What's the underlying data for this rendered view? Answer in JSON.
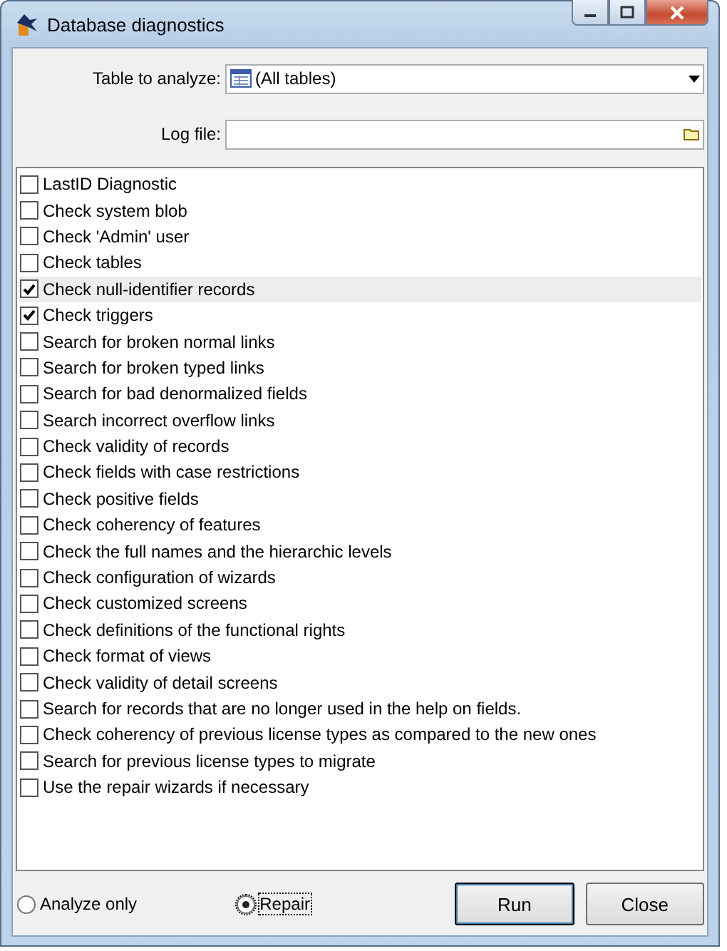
{
  "window": {
    "title": "Database diagnostics"
  },
  "table_field": {
    "label": "Table to analyze:",
    "value": "(All tables)"
  },
  "log_field": {
    "label": "Log file:"
  },
  "checks": [
    {
      "label": "LastID Diagnostic",
      "checked": false,
      "selected": false
    },
    {
      "label": "Check system blob",
      "checked": false,
      "selected": false
    },
    {
      "label": "Check 'Admin' user",
      "checked": false,
      "selected": false
    },
    {
      "label": "Check tables",
      "checked": false,
      "selected": false
    },
    {
      "label": "Check null-identifier records",
      "checked": true,
      "selected": true
    },
    {
      "label": "Check triggers",
      "checked": true,
      "selected": false
    },
    {
      "label": "Search for broken normal links",
      "checked": false,
      "selected": false
    },
    {
      "label": "Search for broken typed links",
      "checked": false,
      "selected": false
    },
    {
      "label": "Search for bad denormalized fields",
      "checked": false,
      "selected": false
    },
    {
      "label": "Search incorrect overflow links",
      "checked": false,
      "selected": false
    },
    {
      "label": "Check validity of records",
      "checked": false,
      "selected": false
    },
    {
      "label": "Check fields with case restrictions",
      "checked": false,
      "selected": false
    },
    {
      "label": "Check positive fields",
      "checked": false,
      "selected": false
    },
    {
      "label": "Check coherency of features",
      "checked": false,
      "selected": false
    },
    {
      "label": "Check the full names and the hierarchic levels",
      "checked": false,
      "selected": false
    },
    {
      "label": "Check configuration of wizards",
      "checked": false,
      "selected": false
    },
    {
      "label": "Check customized screens",
      "checked": false,
      "selected": false
    },
    {
      "label": "Check definitions of the functional rights",
      "checked": false,
      "selected": false
    },
    {
      "label": "Check format of views",
      "checked": false,
      "selected": false
    },
    {
      "label": "Check validity of detail screens",
      "checked": false,
      "selected": false
    },
    {
      "label": "Search for records that are no longer used in the help on fields.",
      "checked": false,
      "selected": false
    },
    {
      "label": "Check coherency of previous license types as compared to the new ones",
      "checked": false,
      "selected": false
    },
    {
      "label": "Search for previous license types to migrate",
      "checked": false,
      "selected": false
    },
    {
      "label": "Use the repair wizards if necessary",
      "checked": false,
      "selected": false
    }
  ],
  "modes": [
    {
      "label": "Analyze only",
      "selected": false
    },
    {
      "label": "Repair",
      "selected": true
    }
  ],
  "buttons": [
    {
      "label": "Run",
      "kind": "default"
    },
    {
      "label": "Close",
      "kind": "normal"
    }
  ]
}
